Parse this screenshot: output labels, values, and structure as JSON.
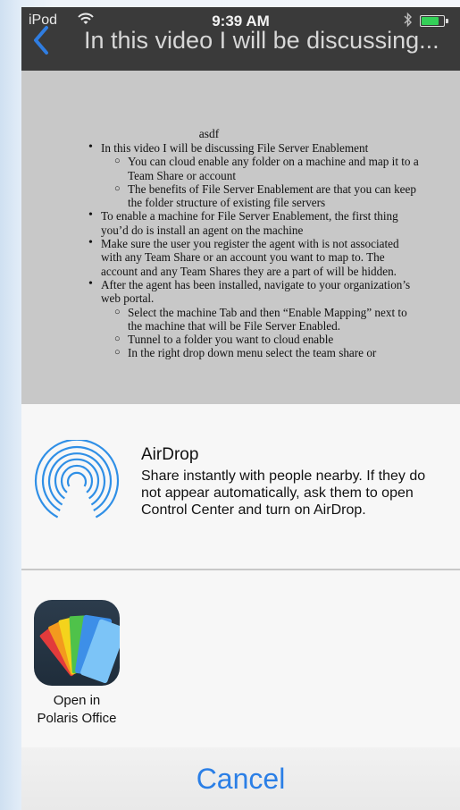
{
  "status_bar": {
    "carrier": "iPod",
    "time": "9:39 AM",
    "battery_level": 0.85
  },
  "nav": {
    "title": "In this video I will be discussing..."
  },
  "document": {
    "heading": "asdf",
    "items": [
      {
        "level": 1,
        "text": "In this video I will be discussing File Server Enablement"
      },
      {
        "level": 2,
        "text": "You can cloud enable any folder on a machine and map it to a Team Share or account"
      },
      {
        "level": 2,
        "text": "The benefits of File Server Enablement are that you can keep the folder structure of existing file servers"
      },
      {
        "level": 1,
        "text": "To enable a machine for File Server Enablement, the first thing you’d do is install an agent on the machine"
      },
      {
        "level": 1,
        "text": "Make sure the user you register the agent with is not associated with any Team Share or an account you want to map to. The account and any Team Shares they are a part of will be hidden."
      },
      {
        "level": 1,
        "text": "After the agent has been installed, navigate to your organization’s web portal."
      },
      {
        "level": 2,
        "text": "Select the machine Tab and then “Enable Mapping” next to the machine that will be File Server Enabled."
      },
      {
        "level": 2,
        "text": "Tunnel to a folder you want to cloud enable"
      },
      {
        "level": 2,
        "text": "In the right drop down menu select the team share or"
      }
    ]
  },
  "share_sheet": {
    "airdrop": {
      "title": "AirDrop",
      "description": "Share instantly with people nearby. If they do not appear automatically, ask them to open Control Center and turn on AirDrop."
    },
    "apps": [
      {
        "icon": "polaris-office-icon",
        "label_line1": "Open in",
        "label_line2": "Polaris Office"
      }
    ],
    "cancel_label": "Cancel"
  },
  "colors": {
    "accent": "#2b7fe6",
    "nav_bar": "#3a3a3a",
    "battery": "#34d058"
  }
}
